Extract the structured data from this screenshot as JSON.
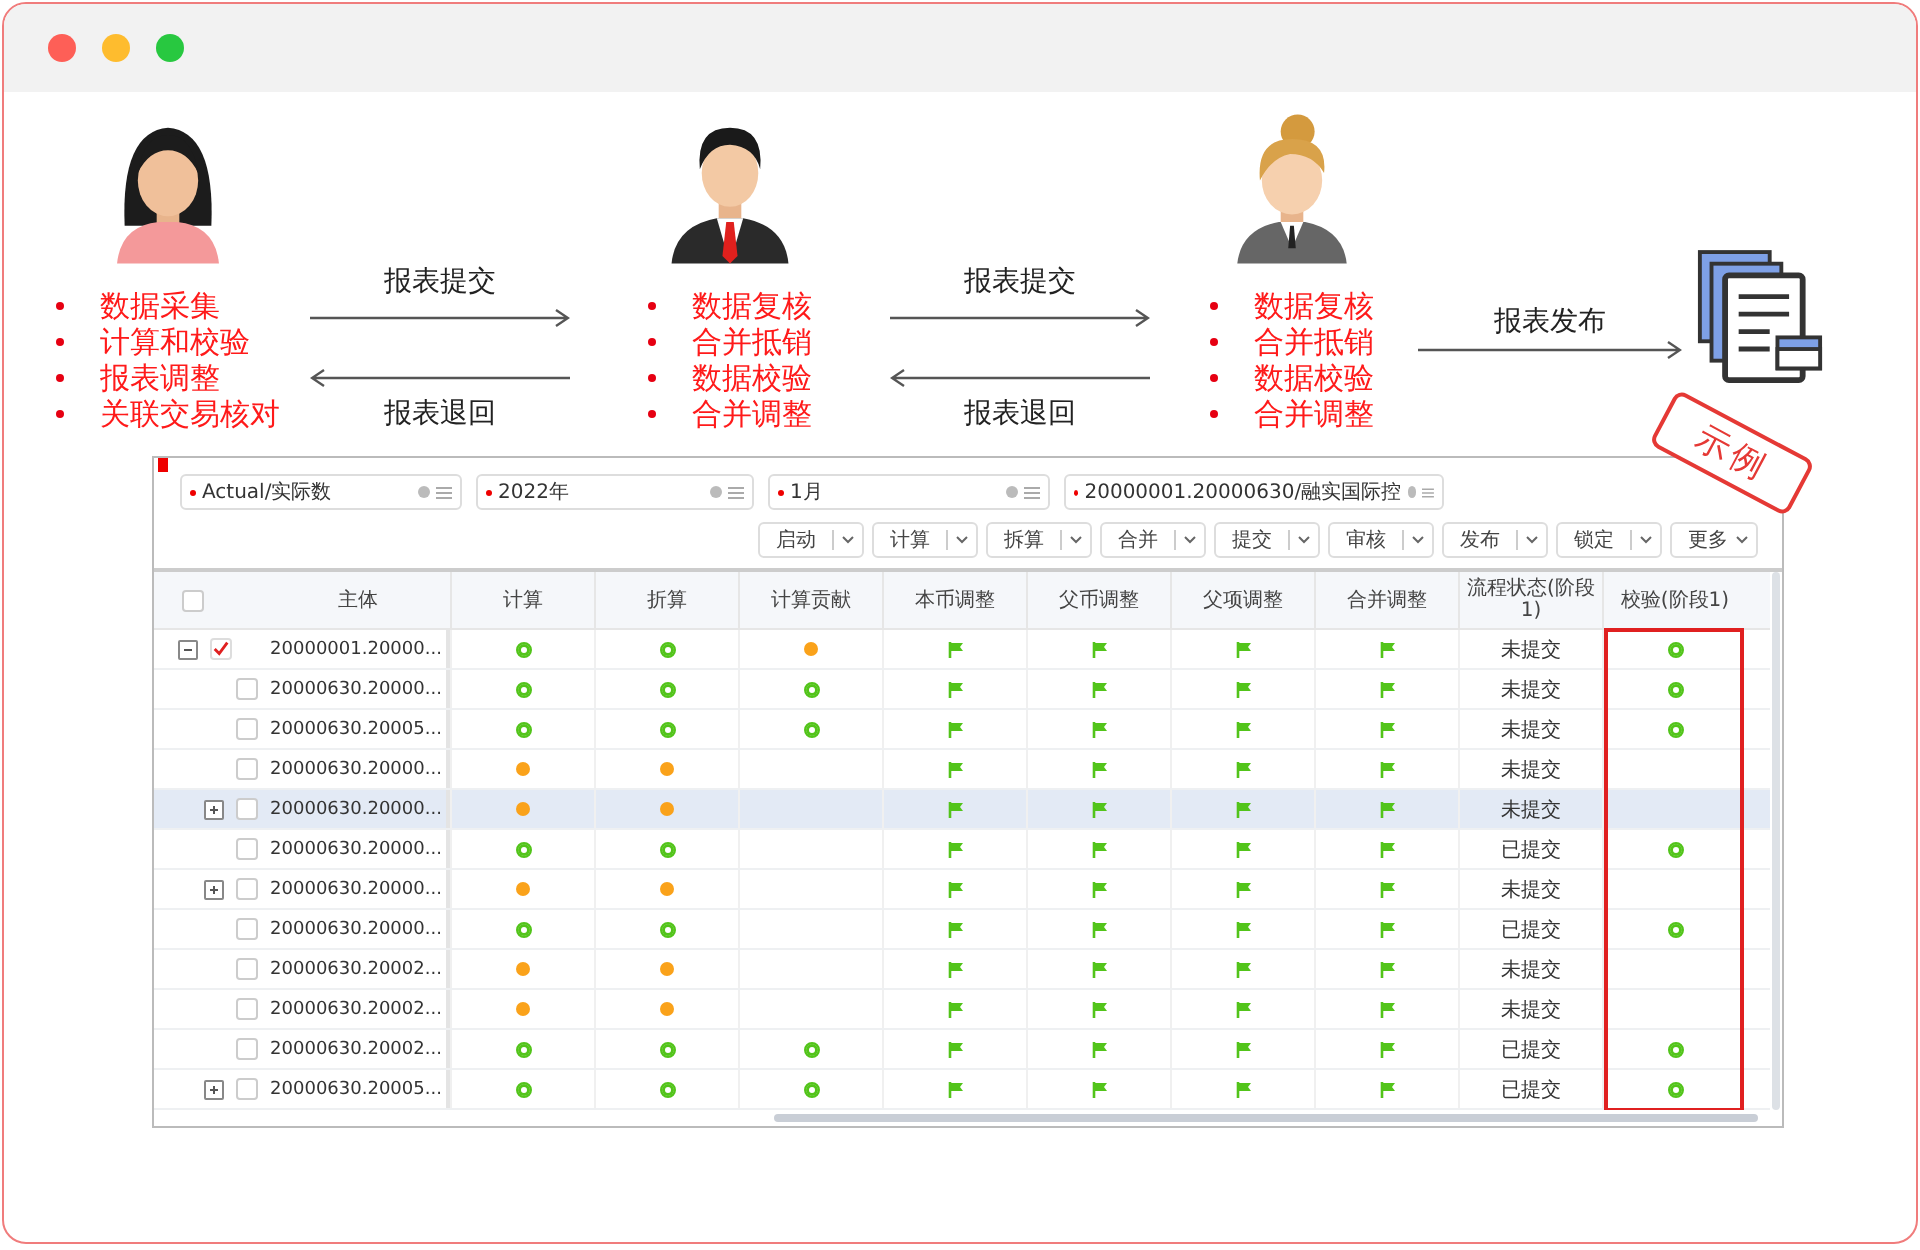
{
  "flow": [
    {
      "kind": "woman",
      "tasks": [
        "数据采集",
        "计算和校验",
        "报表调整",
        "关联交易核对"
      ]
    },
    {
      "kind": "exchange",
      "forward": "报表提交",
      "back": "报表退回"
    },
    {
      "kind": "man",
      "tasks": [
        "数据复核",
        "合并抵销",
        "数据校验",
        "合并调整"
      ]
    },
    {
      "kind": "exchange",
      "forward": "报表提交",
      "back": "报表退回"
    },
    {
      "kind": "manager",
      "tasks": [
        "数据复核",
        "合并抵销",
        "数据校验",
        "合并调整"
      ]
    },
    {
      "kind": "publish",
      "label": "报表发布"
    },
    {
      "kind": "document"
    }
  ],
  "example": {
    "stamp": "示例",
    "filters": [
      {
        "value": "Actual/实际数",
        "required": true
      },
      {
        "value": "2022年",
        "required": true
      },
      {
        "value": "1月",
        "required": true
      },
      {
        "value": "20000001.20000630/融实国际控",
        "required": true
      }
    ],
    "toolbar": [
      {
        "label": "启动",
        "split": true
      },
      {
        "label": "计算",
        "split": true
      },
      {
        "label": "拆算",
        "split": true
      },
      {
        "label": "合并",
        "split": true
      },
      {
        "label": "提交",
        "split": true
      },
      {
        "label": "审核",
        "split": true
      },
      {
        "label": "发布",
        "split": true
      },
      {
        "label": "锁定",
        "split": true
      },
      {
        "label": "更多",
        "split": false
      }
    ],
    "table": {
      "header_checked": false,
      "columns": [
        {
          "label": "主体",
          "highlighted": false
        },
        {
          "label": "计算",
          "highlighted": false
        },
        {
          "label": "折算",
          "highlighted": false
        },
        {
          "label": "计算贡献",
          "highlighted": false
        },
        {
          "label": "本币调整",
          "highlighted": false
        },
        {
          "label": "父币调整",
          "highlighted": false
        },
        {
          "label": "父项调整",
          "highlighted": false
        },
        {
          "label": "合并调整",
          "highlighted": false
        },
        {
          "label": "流程状态(阶段1)",
          "highlighted": false
        },
        {
          "label": "校验(阶段1)",
          "highlighted": true
        }
      ],
      "rows": [
        {
          "entity": "20000001.20000...",
          "expanded": true,
          "checked": true,
          "selected": false,
          "cells": [
            {
              "kind": "ok"
            },
            {
              "kind": "ok"
            },
            {
              "kind": "pending"
            },
            {
              "kind": "flag"
            },
            {
              "kind": "flag"
            },
            {
              "kind": "flag"
            },
            {
              "kind": "flag"
            }
          ],
          "status": "未提交",
          "validation": {
            "kind": "ok"
          },
          "children": [
            {
              "entity": "20000630.20000...",
              "checked": false,
              "selected": false,
              "cells": [
                {
                  "kind": "ok"
                },
                {
                  "kind": "ok"
                },
                {
                  "kind": "ok"
                },
                {
                  "kind": "flag"
                },
                {
                  "kind": "flag"
                },
                {
                  "kind": "flag"
                },
                {
                  "kind": "flag"
                }
              ],
              "status": "未提交",
              "validation": {
                "kind": "ok"
              }
            },
            {
              "entity": "20000630.20005...",
              "checked": false,
              "selected": false,
              "cells": [
                {
                  "kind": "ok"
                },
                {
                  "kind": "ok"
                },
                {
                  "kind": "ok"
                },
                {
                  "kind": "flag"
                },
                {
                  "kind": "flag"
                },
                {
                  "kind": "flag"
                },
                {
                  "kind": "flag"
                }
              ],
              "status": "未提交",
              "validation": {
                "kind": "ok"
              }
            },
            {
              "entity": "20000630.20000...",
              "checked": false,
              "selected": false,
              "cells": [
                {
                  "kind": "pending"
                },
                {
                  "kind": "pending"
                },
                {
                  "kind": "none"
                },
                {
                  "kind": "flag"
                },
                {
                  "kind": "flag"
                },
                {
                  "kind": "flag"
                },
                {
                  "kind": "flag"
                }
              ],
              "status": "未提交",
              "validation": {
                "kind": "none"
              }
            },
            {
              "entity": "20000630.20000...",
              "expanded": false,
              "checked": false,
              "selected": true,
              "cells": [
                {
                  "kind": "pending"
                },
                {
                  "kind": "pending"
                },
                {
                  "kind": "none"
                },
                {
                  "kind": "flag"
                },
                {
                  "kind": "flag"
                },
                {
                  "kind": "flag"
                },
                {
                  "kind": "flag"
                }
              ],
              "status": "未提交",
              "validation": {
                "kind": "none"
              }
            },
            {
              "entity": "20000630.20000...",
              "checked": false,
              "selected": false,
              "cells": [
                {
                  "kind": "ok"
                },
                {
                  "kind": "ok"
                },
                {
                  "kind": "none"
                },
                {
                  "kind": "flag"
                },
                {
                  "kind": "flag"
                },
                {
                  "kind": "flag"
                },
                {
                  "kind": "flag"
                }
              ],
              "status": "已提交",
              "validation": {
                "kind": "ok"
              }
            },
            {
              "entity": "20000630.20000...",
              "expanded": false,
              "checked": false,
              "selected": false,
              "cells": [
                {
                  "kind": "pending"
                },
                {
                  "kind": "pending"
                },
                {
                  "kind": "none"
                },
                {
                  "kind": "flag"
                },
                {
                  "kind": "flag"
                },
                {
                  "kind": "flag"
                },
                {
                  "kind": "flag"
                }
              ],
              "status": "未提交",
              "validation": {
                "kind": "none"
              }
            },
            {
              "entity": "20000630.20000...",
              "checked": false,
              "selected": false,
              "cells": [
                {
                  "kind": "ok"
                },
                {
                  "kind": "ok"
                },
                {
                  "kind": "none"
                },
                {
                  "kind": "flag"
                },
                {
                  "kind": "flag"
                },
                {
                  "kind": "flag"
                },
                {
                  "kind": "flag"
                }
              ],
              "status": "已提交",
              "validation": {
                "kind": "ok"
              }
            },
            {
              "entity": "20000630.20002...",
              "checked": false,
              "selected": false,
              "cells": [
                {
                  "kind": "pending"
                },
                {
                  "kind": "pending"
                },
                {
                  "kind": "none"
                },
                {
                  "kind": "flag"
                },
                {
                  "kind": "flag"
                },
                {
                  "kind": "flag"
                },
                {
                  "kind": "flag"
                }
              ],
              "status": "未提交",
              "validation": {
                "kind": "none"
              }
            },
            {
              "entity": "20000630.20002...",
              "checked": false,
              "selected": false,
              "cells": [
                {
                  "kind": "pending"
                },
                {
                  "kind": "pending"
                },
                {
                  "kind": "none"
                },
                {
                  "kind": "flag"
                },
                {
                  "kind": "flag"
                },
                {
                  "kind": "flag"
                },
                {
                  "kind": "flag"
                }
              ],
              "status": "未提交",
              "validation": {
                "kind": "none"
              }
            },
            {
              "entity": "20000630.20002...",
              "checked": false,
              "selected": false,
              "cells": [
                {
                  "kind": "ok"
                },
                {
                  "kind": "ok"
                },
                {
                  "kind": "ok"
                },
                {
                  "kind": "flag"
                },
                {
                  "kind": "flag"
                },
                {
                  "kind": "flag"
                },
                {
                  "kind": "flag"
                }
              ],
              "status": "已提交",
              "validation": {
                "kind": "ok"
              }
            },
            {
              "entity": "20000630.20005...",
              "expanded": false,
              "checked": false,
              "selected": false,
              "cells": [
                {
                  "kind": "ok"
                },
                {
                  "kind": "ok"
                },
                {
                  "kind": "ok"
                },
                {
                  "kind": "flag"
                },
                {
                  "kind": "flag"
                },
                {
                  "kind": "flag"
                },
                {
                  "kind": "flag"
                }
              ],
              "status": "已提交",
              "validation": {
                "kind": "ok"
              }
            }
          ]
        }
      ]
    }
  }
}
